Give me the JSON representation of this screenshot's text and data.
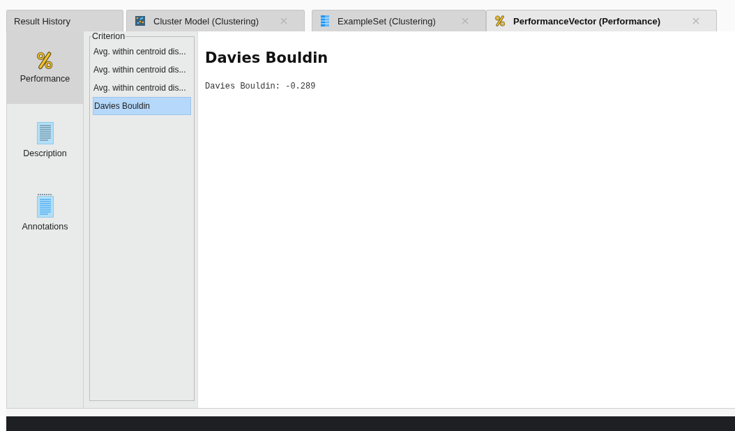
{
  "tabs": [
    {
      "label": "Result History",
      "kind": "plain",
      "closable": false,
      "selected": false
    },
    {
      "label": "Cluster Model (Clustering)",
      "kind": "cluster",
      "closable": true,
      "selected": false
    },
    {
      "label": "ExampleSet (Clustering)",
      "kind": "table",
      "closable": true,
      "selected": false
    },
    {
      "label": "PerformanceVector (Performance)",
      "kind": "percent",
      "closable": true,
      "selected": true
    }
  ],
  "sidebar": {
    "items": [
      {
        "label": "Performance",
        "kind": "percent",
        "selected": true
      },
      {
        "label": "Description",
        "kind": "document",
        "selected": false
      },
      {
        "label": "Annotations",
        "kind": "notepad",
        "selected": false
      }
    ]
  },
  "criterion": {
    "title": "Criterion",
    "items": [
      {
        "label": "Avg. within centroid dis...",
        "selected": false
      },
      {
        "label": "Avg. within centroid dis...",
        "selected": false
      },
      {
        "label": "Avg. within centroid dis...",
        "selected": false
      },
      {
        "label": "Davies Bouldin",
        "selected": true
      }
    ]
  },
  "content": {
    "heading": "Davies Bouldin",
    "value_line": "Davies Bouldin: -0.289"
  }
}
